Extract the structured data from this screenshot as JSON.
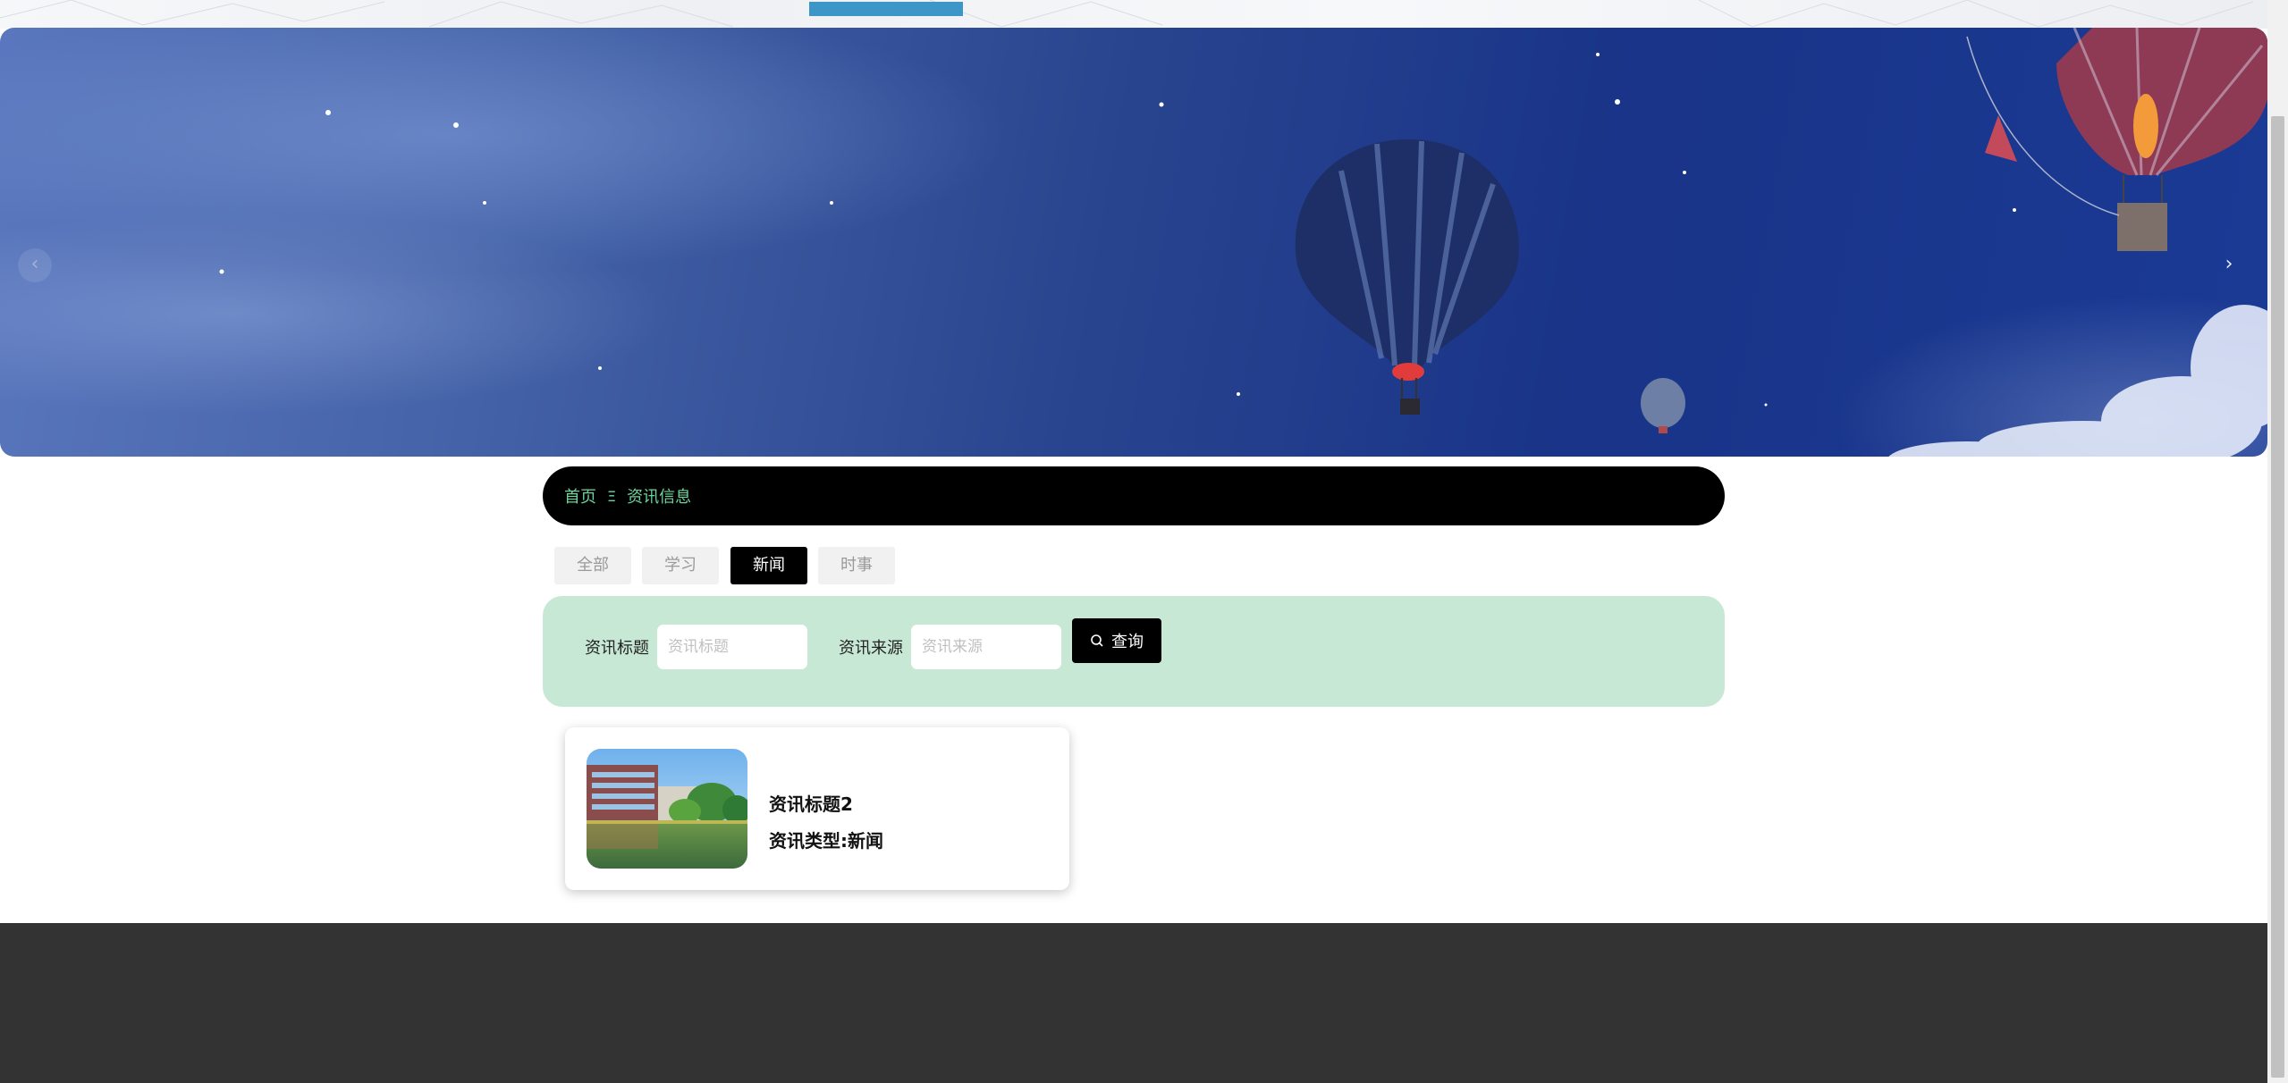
{
  "breadcrumb": {
    "home": "首页",
    "separator": "Ξ",
    "current": "资讯信息"
  },
  "tabs": [
    {
      "label": "全部",
      "active": false
    },
    {
      "label": "学习",
      "active": false
    },
    {
      "label": "新闻",
      "active": true
    },
    {
      "label": "时事",
      "active": false
    }
  ],
  "search": {
    "title_label": "资讯标题",
    "title_placeholder": "资讯标题",
    "source_label": "资讯来源",
    "source_placeholder": "资讯来源",
    "button_label": "查询",
    "button_icon": "search-icon"
  },
  "carousel": {
    "slides": 3,
    "active_slide": 1,
    "prev_icon": "chevron-left-icon",
    "next_icon": "chevron-right-icon"
  },
  "news": [
    {
      "title": "资讯标题2",
      "type_text": "资讯类型:新闻",
      "thumbnail": "campus-building-photo"
    }
  ],
  "colors": {
    "accent_green": "#6dd49a",
    "panel_green": "#c8e8d6",
    "active_tab": "#000000",
    "footer": "#333333",
    "top_indicator": "#3d96c8"
  }
}
